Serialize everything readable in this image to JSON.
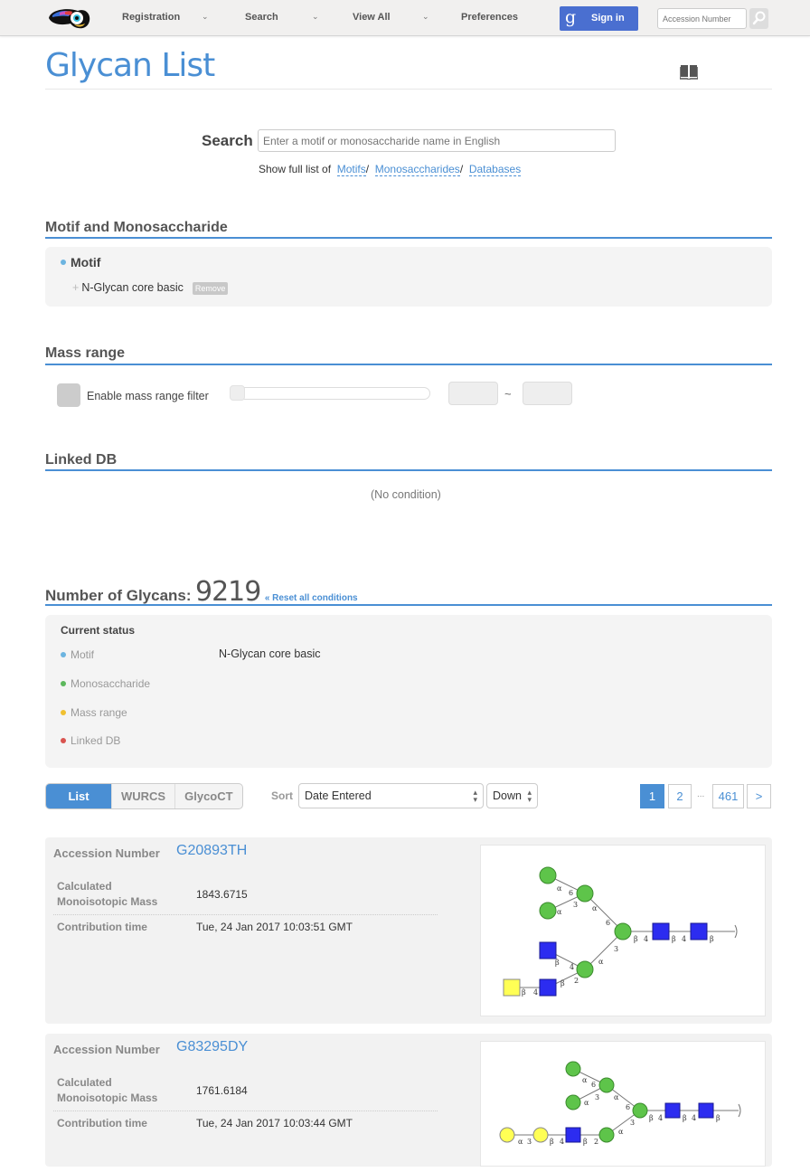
{
  "nav": {
    "items": [
      {
        "label": "Registration",
        "has_dropdown": true
      },
      {
        "label": "Search",
        "has_dropdown": true
      },
      {
        "label": "View All",
        "has_dropdown": true
      },
      {
        "label": "Preferences",
        "has_dropdown": false
      }
    ],
    "sign_in": {
      "icon": "google-g-icon",
      "glyph": "g",
      "label": "Sign in"
    },
    "accession_placeholder": "Accession Number",
    "search_icon": "magnifier-icon"
  },
  "page": {
    "title": "Glycan List",
    "book_icon": "open-book-icon"
  },
  "search": {
    "label": "Search",
    "placeholder": "Enter a motif or monosaccharide name in English",
    "full_list_prefix": "Show full list of",
    "links": [
      "Motifs",
      "Monosaccharides",
      "Databases"
    ],
    "separator": "/"
  },
  "motif_section": {
    "heading": "Motif and Monosaccharide",
    "group_label": "Motif",
    "items": [
      {
        "name": "N-Glycan core basic",
        "remove_label": "Remove"
      }
    ],
    "accent": "#6cb4e0"
  },
  "mass_section": {
    "heading": "Mass range",
    "checkbox_label": "Enable mass range filter",
    "min_value": "",
    "max_value": "",
    "tilde": "~"
  },
  "linked_section": {
    "heading": "Linked DB",
    "empty_text": "(No condition)"
  },
  "results": {
    "heading": "Number of Glycans:",
    "count": "9219",
    "reset_label": "« Reset all conditions",
    "status": {
      "title": "Current status",
      "rows": [
        {
          "label": "Motif",
          "value": "N-Glycan core basic",
          "color": "#6cb4e0"
        },
        {
          "label": "Monosaccharide",
          "value": "",
          "color": "#5cb85c"
        },
        {
          "label": "Mass range",
          "value": "",
          "color": "#f0c030"
        },
        {
          "label": "Linked DB",
          "value": "",
          "color": "#d9534f"
        }
      ]
    }
  },
  "toolbar": {
    "view_tabs": [
      "List",
      "WURCS",
      "GlycoCT"
    ],
    "active_tab": "List",
    "sort_label": "Sort",
    "sort_value": "Date Entered",
    "order_value": "Down",
    "pagination": {
      "pages": [
        "1",
        "2"
      ],
      "ellipsis": "...",
      "last": "461",
      "next": ">",
      "current": "1"
    }
  },
  "glycans": [
    {
      "accession_label": "Accession Number",
      "accession": "G20893TH",
      "mass_label": [
        "Calculated",
        "Monoisotopic Mass"
      ],
      "mass": "1843.6715",
      "time_label": "Contribution time",
      "time": "Tue, 24 Jan 2017 10:03:51 GMT"
    },
    {
      "accession_label": "Accession Number",
      "accession": "G83295DY",
      "mass_label": [
        "Calculated",
        "Monoisotopic Mass"
      ],
      "mass": "1761.6184",
      "time_label": "Contribution time",
      "time": "Tue, 24 Jan 2017 10:03:44 GMT"
    }
  ],
  "colors": {
    "accent": "#4a8fd4",
    "signin": "#4a6fd0",
    "mannose": "#5ec44a",
    "glcnac": "#2c2cf0",
    "galactose": "#ffff55"
  }
}
